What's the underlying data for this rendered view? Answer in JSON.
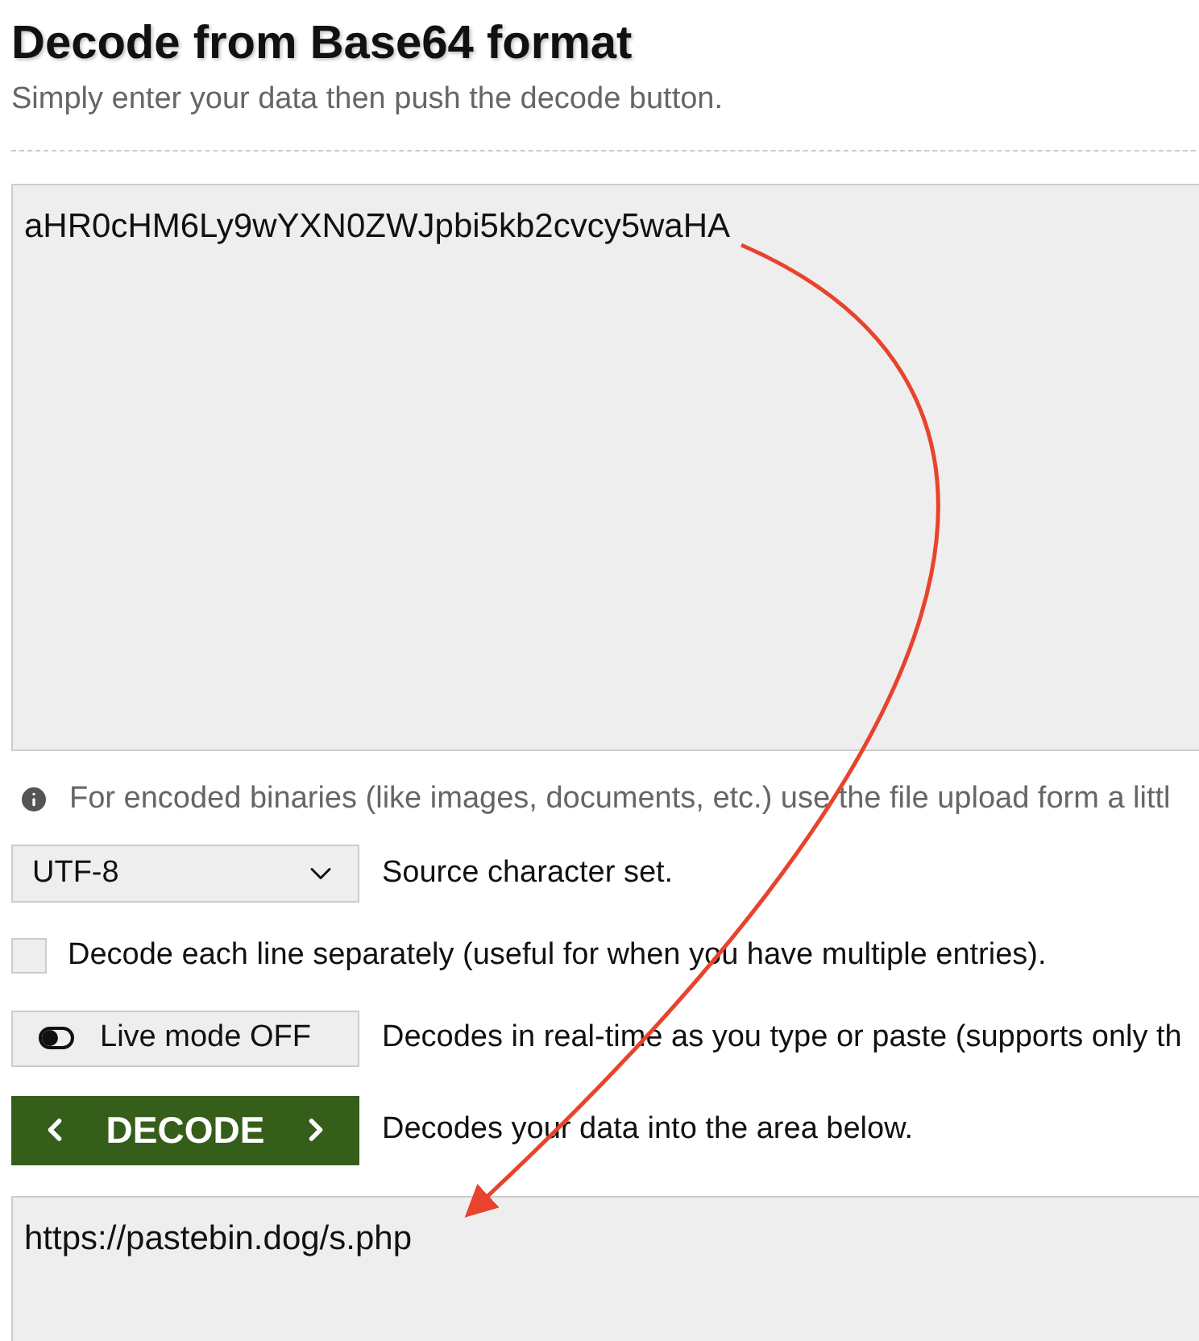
{
  "title": "Decode from Base64 format",
  "subtitle": "Simply enter your data then push the decode button.",
  "input": {
    "value": "aHR0cHM6Ly9wYXN0ZWJpbi5kb2cvcy5waHA"
  },
  "info_note": "For encoded binaries (like images, documents, etc.) use the file upload form a littl",
  "charset": {
    "value": "UTF-8",
    "description": "Source character set."
  },
  "split_lines": {
    "checked": false,
    "label": "Decode each line separately (useful for when you have multiple entries)."
  },
  "live_mode": {
    "on": false,
    "label": "Live mode OFF",
    "description": "Decodes in real-time as you type or paste (supports only th"
  },
  "decode": {
    "label": "DECODE",
    "description": "Decodes your data into the area below."
  },
  "output": {
    "value": "https://pastebin.dog/s.php"
  }
}
